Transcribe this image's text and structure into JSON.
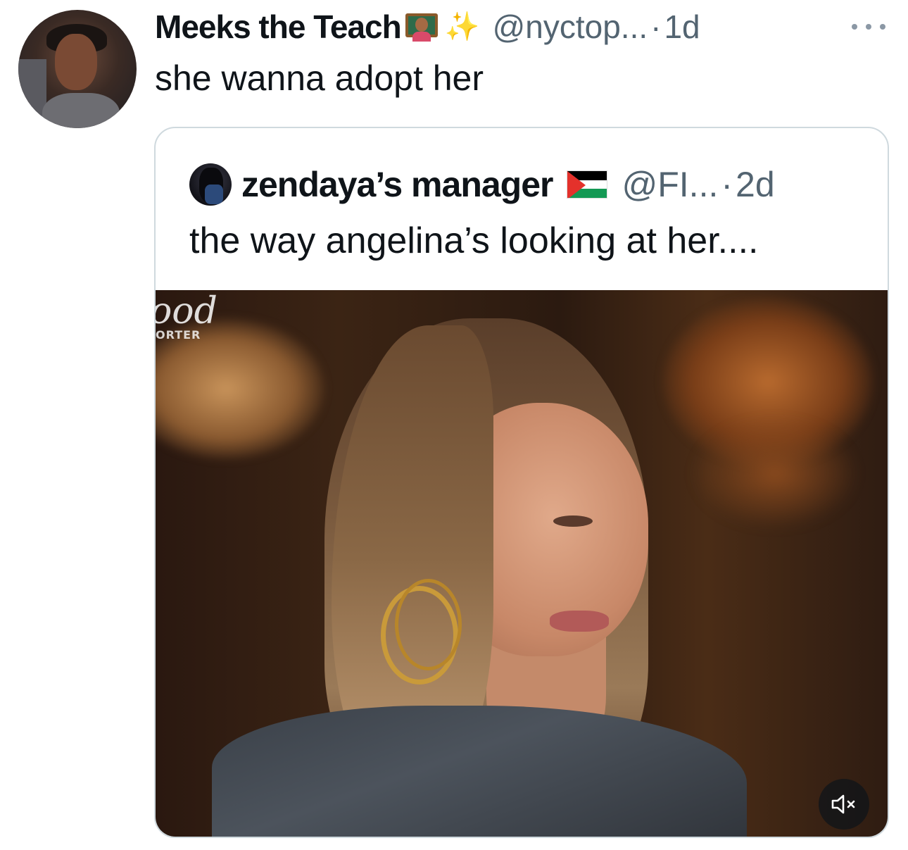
{
  "tweet": {
    "display_name": "Meeks the Teach",
    "name_emoji": "teacher-emoji",
    "sparkles": "✨",
    "handle": "@nyctop...",
    "separator": "·",
    "time": "1d",
    "text": "she wanna adopt her"
  },
  "quote": {
    "display_name": "zendaya’s manager",
    "flag": "palestine-flag-icon",
    "handle": "@FI...",
    "separator": "·",
    "time": "2d",
    "text": "the way angelina’s looking at her....",
    "video": {
      "watermark": "ood",
      "watermark_sub": "ORTER",
      "mute_icon": "muted-speaker-icon"
    }
  },
  "colors": {
    "text_primary": "#0f1419",
    "text_secondary": "#536471",
    "card_border": "#cfd9de"
  }
}
